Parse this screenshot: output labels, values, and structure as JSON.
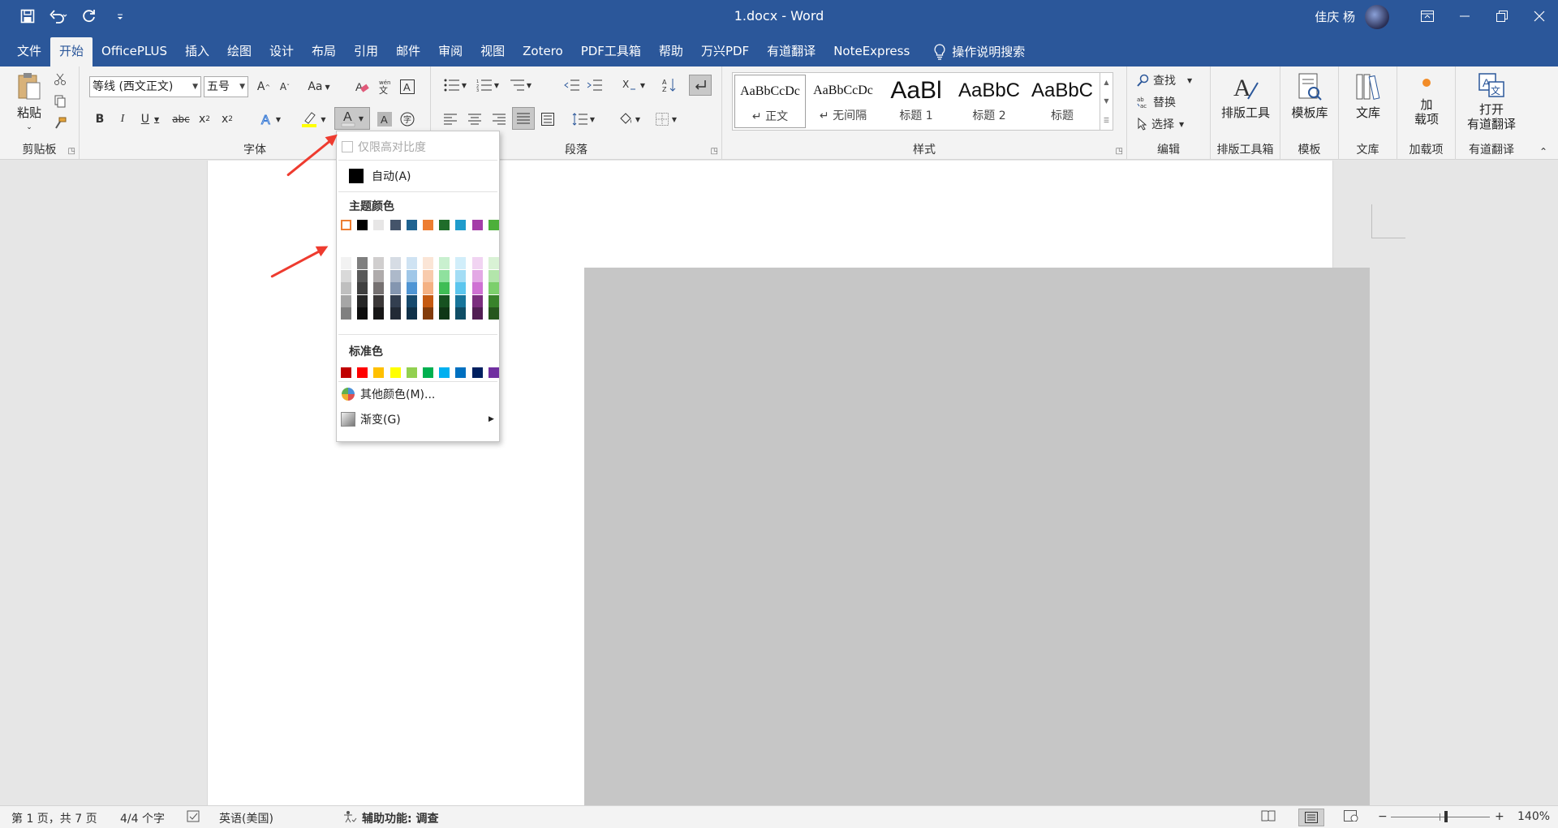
{
  "window": {
    "title": "1.docx  -  Word",
    "user": "佳庆 杨",
    "accent": "#2b579a"
  },
  "tabs": [
    "文件",
    "开始",
    "OfficePLUS",
    "插入",
    "绘图",
    "设计",
    "布局",
    "引用",
    "邮件",
    "审阅",
    "视图",
    "Zotero",
    "PDF工具箱",
    "帮助",
    "万兴PDF",
    "有道翻译",
    "NoteExpress"
  ],
  "tell_me": "操作说明搜索",
  "ribbon": {
    "clipboard": {
      "paste": "粘贴",
      "label": "剪贴板"
    },
    "font": {
      "name": "等线 (西文正文)",
      "size": "五号",
      "aa": "Aa",
      "label": "字体"
    },
    "paragraph": {
      "label": "段落"
    },
    "styles": {
      "label": "样式",
      "items": [
        {
          "sample": "AaBbCcDc",
          "name": "↵ 正文"
        },
        {
          "sample": "AaBbCcDc",
          "name": "↵ 无间隔"
        },
        {
          "sample": "AaBl",
          "name": "标题 1"
        },
        {
          "sample": "AaBbC",
          "name": "标题 2"
        },
        {
          "sample": "AaBbC",
          "name": "标题"
        }
      ]
    },
    "editing": {
      "find": "查找",
      "replace": "替换",
      "select": "选择",
      "label": "编辑"
    },
    "typeset": {
      "button": "排版工具",
      "label": "排版工具箱"
    },
    "template": {
      "button": "模板库",
      "label": "模板"
    },
    "library": {
      "button": "文库",
      "label": "文库"
    },
    "addins": {
      "button_line1": "加",
      "button_line2": "载项",
      "label": "加载项"
    },
    "youdao": {
      "button_line1": "打开",
      "button_line2": "有道翻译",
      "label": "有道翻译"
    }
  },
  "color_menu": {
    "high_contrast": "仅限高对比度",
    "auto": "自动(A)",
    "theme_colors_title": "主题颜色",
    "theme_top": [
      "#ffffff",
      "#000000",
      "#e7e6e6",
      "#44546a",
      "#1f6391",
      "#ed7d31",
      "#1f6d2a",
      "#1f9ccc",
      "#a43da8",
      "#4caf3a"
    ],
    "theme_shades": [
      [
        "#f2f2f2",
        "#d9d9d9",
        "#bfbfbf",
        "#a6a6a6",
        "#808080"
      ],
      [
        "#7f7f7f",
        "#595959",
        "#404040",
        "#262626",
        "#0d0d0d"
      ],
      [
        "#d0cece",
        "#afabab",
        "#767171",
        "#3b3838",
        "#171616"
      ],
      [
        "#d6dce4",
        "#adb9ca",
        "#8496b0",
        "#333f50",
        "#222a35"
      ],
      [
        "#cfe3f3",
        "#a0c7e8",
        "#4f95d4",
        "#174a6e",
        "#0f3149"
      ],
      [
        "#fbe5d6",
        "#f8cbad",
        "#f4b183",
        "#c55a11",
        "#833c0b"
      ],
      [
        "#c9f0cf",
        "#8fe19e",
        "#3fbd55",
        "#175221",
        "#0f3616"
      ],
      [
        "#d1eefa",
        "#a3ddf5",
        "#5cc6ee",
        "#17759a",
        "#0f4e66"
      ],
      [
        "#f1d4f2",
        "#e3a9e5",
        "#cf71d3",
        "#7b2e7e",
        "#521f54"
      ],
      [
        "#d9f2d5",
        "#b3e5ab",
        "#7ccf6c",
        "#39832b",
        "#26571d"
      ]
    ],
    "standard_title": "标准色",
    "standard": [
      "#c00000",
      "#ff0000",
      "#ffc000",
      "#ffff00",
      "#92d050",
      "#00b050",
      "#00b0f0",
      "#0070c0",
      "#002060",
      "#7030a0"
    ],
    "more_colors": "其他颜色(M)...",
    "gradient": "渐变(G)"
  },
  "status": {
    "page": "第 1 页，共 7 页",
    "words": "4/4 个字",
    "language": "英语(美国)",
    "accessibility": "辅助功能: 调查",
    "zoom": "140%"
  }
}
